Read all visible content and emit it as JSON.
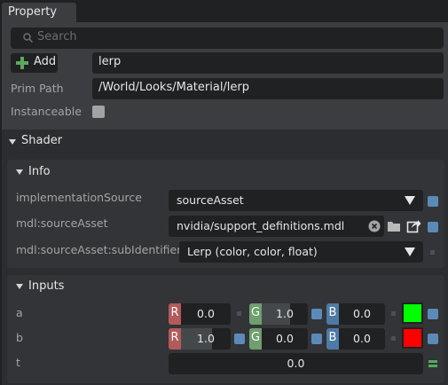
{
  "tab": {
    "label": "Property"
  },
  "search": {
    "placeholder": "Search"
  },
  "toolbar": {
    "add_label": "Add",
    "name_value": "lerp"
  },
  "prim_path": {
    "label": "Prim Path",
    "value": "/World/Looks/Material/lerp"
  },
  "instanceable": {
    "label": "Instanceable",
    "checked": false
  },
  "shader": {
    "title": "Shader"
  },
  "info": {
    "title": "Info",
    "impl_label": "implementationSource",
    "impl_value": "sourceAsset",
    "asset_label": "mdl:sourceAsset",
    "asset_value": "nvidia/support_definitions.mdl",
    "subid_label": "mdl:sourceAsset:subIdentifier",
    "subid_value": "Lerp (color, color, float)"
  },
  "inputs": {
    "title": "Inputs",
    "a": {
      "label": "a",
      "r": "0.0",
      "g": "1.0",
      "b": "0.0",
      "color": "#00ff00",
      "r_level": 0,
      "g_level": 1,
      "b_level": 0
    },
    "b": {
      "label": "b",
      "r": "1.0",
      "g": "0.0",
      "b": "0.0",
      "color": "#ff0000",
      "r_level": 1,
      "g_level": 0,
      "b_level": 0
    },
    "t": {
      "label": "t",
      "value": "0.0"
    }
  },
  "colors": {
    "accent_blue": "#5b8ab8",
    "channel_r": "#b35a5a",
    "channel_g": "#6f9e6f",
    "channel_b": "#4d7aa6",
    "eq_green": "#4fae5a"
  }
}
